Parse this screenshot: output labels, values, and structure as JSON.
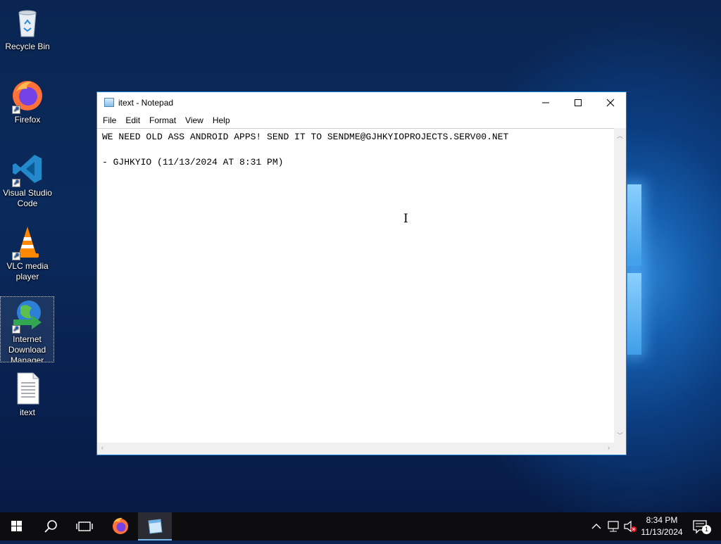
{
  "desktop": {
    "icons": [
      {
        "label": "Recycle Bin"
      },
      {
        "label": "Firefox"
      },
      {
        "label": "Visual Studio Code"
      },
      {
        "label": "VLC media player"
      },
      {
        "label": "Internet Download Manager"
      },
      {
        "label": "itext"
      }
    ]
  },
  "notepad": {
    "title": "itext - Notepad",
    "menu": [
      "File",
      "Edit",
      "Format",
      "View",
      "Help"
    ],
    "content": "WE NEED OLD ASS ANDROID APPS! SEND IT TO SENDME@GJHKYIOPROJECTS.SERV00.NET\n\n- GJHKYIO (11/13/2024 AT 8:31 PM)"
  },
  "taskbar": {
    "time": "8:34 PM",
    "date": "11/13/2024",
    "notification_count": "1"
  }
}
